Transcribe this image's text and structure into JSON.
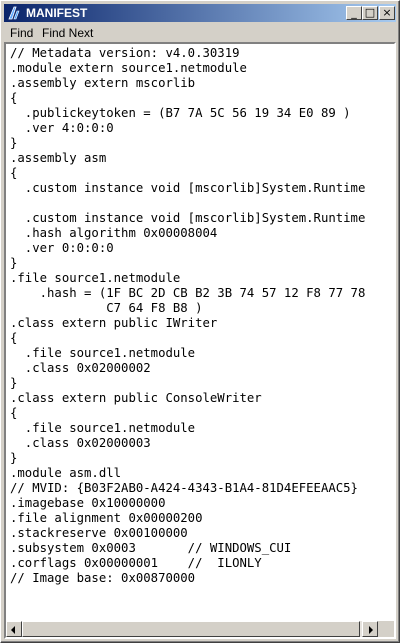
{
  "window": {
    "title": "MANIFEST",
    "minimize_glyph": "_",
    "maximize_glyph": "□",
    "close_glyph": "×"
  },
  "menu": {
    "find": "Find",
    "find_next": "Find Next"
  },
  "code": [
    "// Metadata version: v4.0.30319",
    ".module extern source1.netmodule",
    ".assembly extern mscorlib",
    "{",
    "  .publickeytoken = (B7 7A 5C 56 19 34 E0 89 )",
    "  .ver 4:0:0:0",
    "}",
    ".assembly asm",
    "{",
    "  .custom instance void [mscorlib]System.Runtime",
    "",
    "  .custom instance void [mscorlib]System.Runtime",
    "  .hash algorithm 0x00008004",
    "  .ver 0:0:0:0",
    "}",
    ".file source1.netmodule",
    "    .hash = (1F BC 2D CB B2 3B 74 57 12 F8 77 78",
    "             C7 64 F8 B8 )",
    ".class extern public IWriter",
    "{",
    "  .file source1.netmodule",
    "  .class 0x02000002",
    "}",
    ".class extern public ConsoleWriter",
    "{",
    "  .file source1.netmodule",
    "  .class 0x02000003",
    "}",
    ".module asm.dll",
    "// MVID: {B03F2AB0-A424-4343-B1A4-81D4EFEEAAC5}",
    ".imagebase 0x10000000",
    ".file alignment 0x00000200",
    ".stackreserve 0x00100000",
    ".subsystem 0x0003       // WINDOWS_CUI",
    ".corflags 0x00000001    //  ILONLY",
    "// Image base: 0x00870000"
  ]
}
